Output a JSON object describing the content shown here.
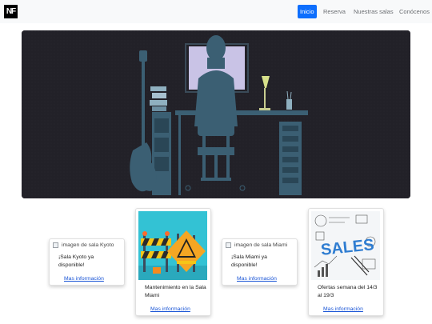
{
  "navbar": {
    "logo_text": "NF",
    "links": [
      {
        "label": "Inicio",
        "active": true
      },
      {
        "label": "Reserva",
        "active": false
      },
      {
        "label": "Nuestras salas",
        "active": false
      },
      {
        "label": "Conócenos",
        "active": false
      }
    ]
  },
  "cards": [
    {
      "img_alt": "imagen de sala Kyoto",
      "text": "¡Sala Kyoto ya disponible!",
      "link": "Mas información"
    },
    {
      "img_alt": "",
      "text": "Mantenimiento en la Sala Miami",
      "link": "Mas información"
    },
    {
      "img_alt": "imagen de sala Miami",
      "text": "¡Sala Miami ya disponible!",
      "link": "Mas información"
    },
    {
      "img_alt": "",
      "text": "Ofertas semana del 14/3 al 19/3",
      "link": "Mas información"
    }
  ],
  "sales_image_text": "SALES",
  "colors": {
    "primary": "#0d6efd",
    "link": "#1a55d6",
    "navbar_bg": "#f8f9fa",
    "hero_bg": "#222128"
  }
}
